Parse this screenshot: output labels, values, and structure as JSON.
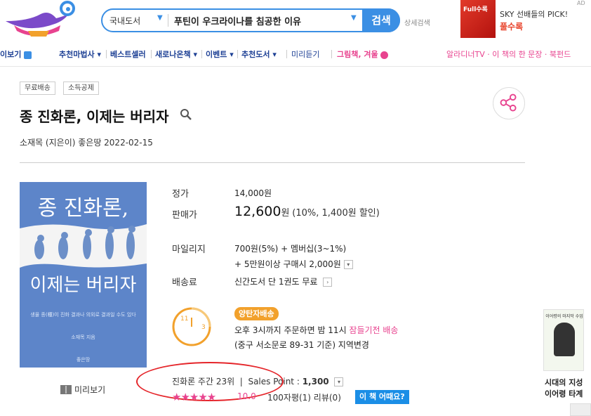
{
  "header": {
    "search_category": "국내도서",
    "search_query": "푸틴이 우크라이나를 침공한 이유",
    "search_button": "검색",
    "detail_search": "상세검색",
    "ad_book_label": "Full수록",
    "ad_line1": "SKY 선배들의 PICK!",
    "ad_line2": "풀수록",
    "ad_tag": "AD"
  },
  "nav": {
    "item_0": "이보기",
    "item_1": "추천마법사",
    "item_2": "베스트셀러",
    "item_3": "새로나온책",
    "item_4": "이벤트",
    "item_5": "추천도서",
    "item_6": "미리듣기",
    "item_7": "그림책, 겨울",
    "right": "알라디너TV · 이 책의 한 문장 · 북펀드"
  },
  "product": {
    "badge_free_shipping": "무료배송",
    "badge_tax": "소득공제",
    "title": "종 진화론, 이제는 버리자",
    "authors": "소재목 (지은이)   좋은땅   2022-02-15"
  },
  "cover": {
    "title_line1": "종 진화론,",
    "title_line2": "이제는 버리자",
    "subtitle": "생물 종(種)이 진화 결과나 의외로 결과일 수도 있다",
    "author": "소재목 지음",
    "publisher": "좋은땅"
  },
  "preview_label": "미리보기",
  "price": {
    "list_label": "정가",
    "list_value": "14,000원",
    "sale_label": "판매가",
    "sale_amount": "12,600",
    "sale_unit": "원",
    "sale_discount": "(10%, 1,400원 할인)",
    "mileage_label": "마일리지",
    "mileage_line1": "700원(5%) + 멤버십(3~1%)",
    "mileage_line2": "+ 5만원이상 구매시 2,000원",
    "shipping_label": "배송료",
    "shipping_value": "신간도서 단 1권도 무료"
  },
  "delivery": {
    "badge": "양탄자배송",
    "line1_a": "오후 3시까지 주문하면 밤 11시 ",
    "line1_b": "잠들기전 배송",
    "line2": "(중구 서소문로 89-31 기준) 지역변경",
    "clock_11": "11",
    "clock_3": "3"
  },
  "rank": {
    "text": "진화론 주간 23위",
    "sales_point_label": "Sales Point : ",
    "sales_point_value": "1,300"
  },
  "rating": {
    "stars": "★★★★★",
    "score": "10.0",
    "review_text": "100자평(1)  리뷰(0)",
    "how_button": "이 책 어때요?"
  },
  "side_ad": {
    "book_title": "이어령의 마지막 수업",
    "line1": "시대의 지성",
    "line2": "이어령 타계"
  },
  "colors": {
    "brand_blue": "#3b8fe4",
    "nav_blue": "#1c3f94",
    "pink": "#e8438f",
    "annotation_red": "#e5262b"
  }
}
